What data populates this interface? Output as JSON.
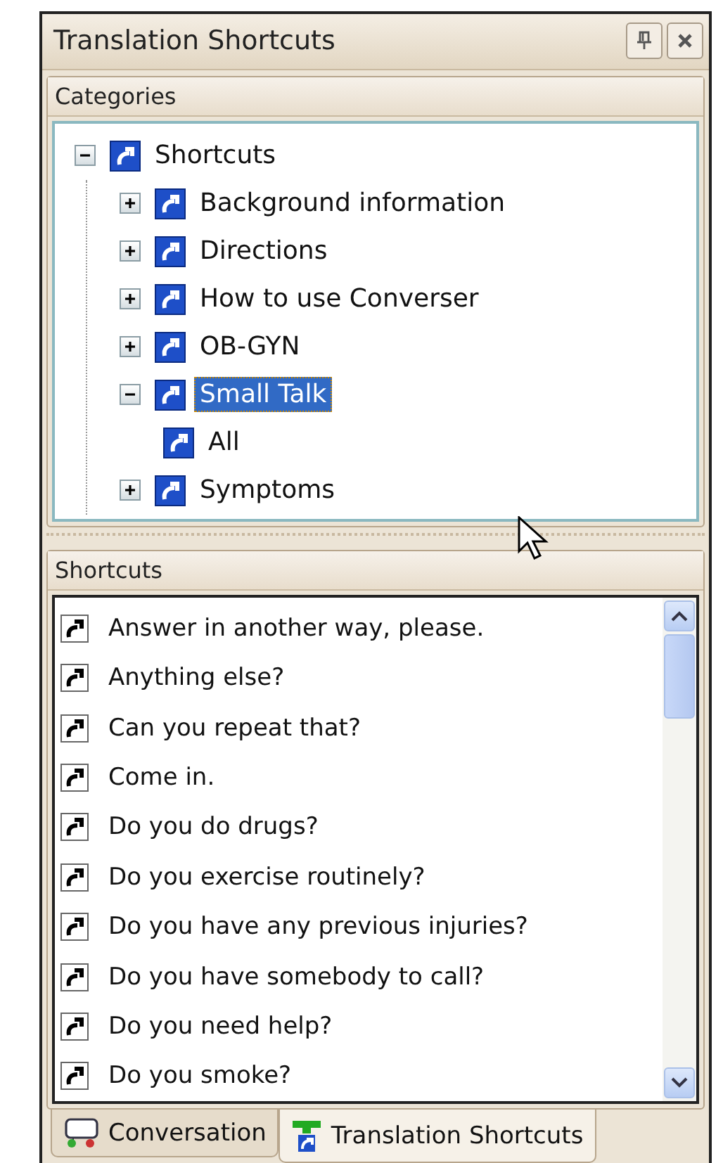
{
  "window": {
    "title": "Translation Shortcuts"
  },
  "categories": {
    "header": "Categories",
    "tree": [
      {
        "label": "Shortcuts",
        "expanded": true,
        "selected": false,
        "children": [
          {
            "label": "Background information",
            "expanded": false,
            "selected": false
          },
          {
            "label": "Directions",
            "expanded": false,
            "selected": false
          },
          {
            "label": "How to use Converser",
            "expanded": false,
            "selected": false
          },
          {
            "label": "OB-GYN",
            "expanded": false,
            "selected": false
          },
          {
            "label": "Small Talk",
            "expanded": true,
            "selected": true,
            "children": [
              {
                "label": "All",
                "selected": false
              }
            ]
          },
          {
            "label": "Symptoms",
            "expanded": false,
            "selected": false
          }
        ]
      }
    ]
  },
  "shortcuts": {
    "header": "Shortcuts",
    "items": [
      "Answer in another way, please.",
      "Anything else?",
      "Can you repeat that?",
      "Come in.",
      "Do you do drugs?",
      "Do you exercise routinely?",
      "Do you have any previous injuries?",
      "Do you have somebody to call?",
      "Do you need help?",
      "Do you smoke?"
    ]
  },
  "tabs": [
    {
      "label": "Conversation",
      "kind": "conversation",
      "selected": false
    },
    {
      "label": "Translation Shortcuts",
      "kind": "shortcuts",
      "selected": true
    }
  ]
}
